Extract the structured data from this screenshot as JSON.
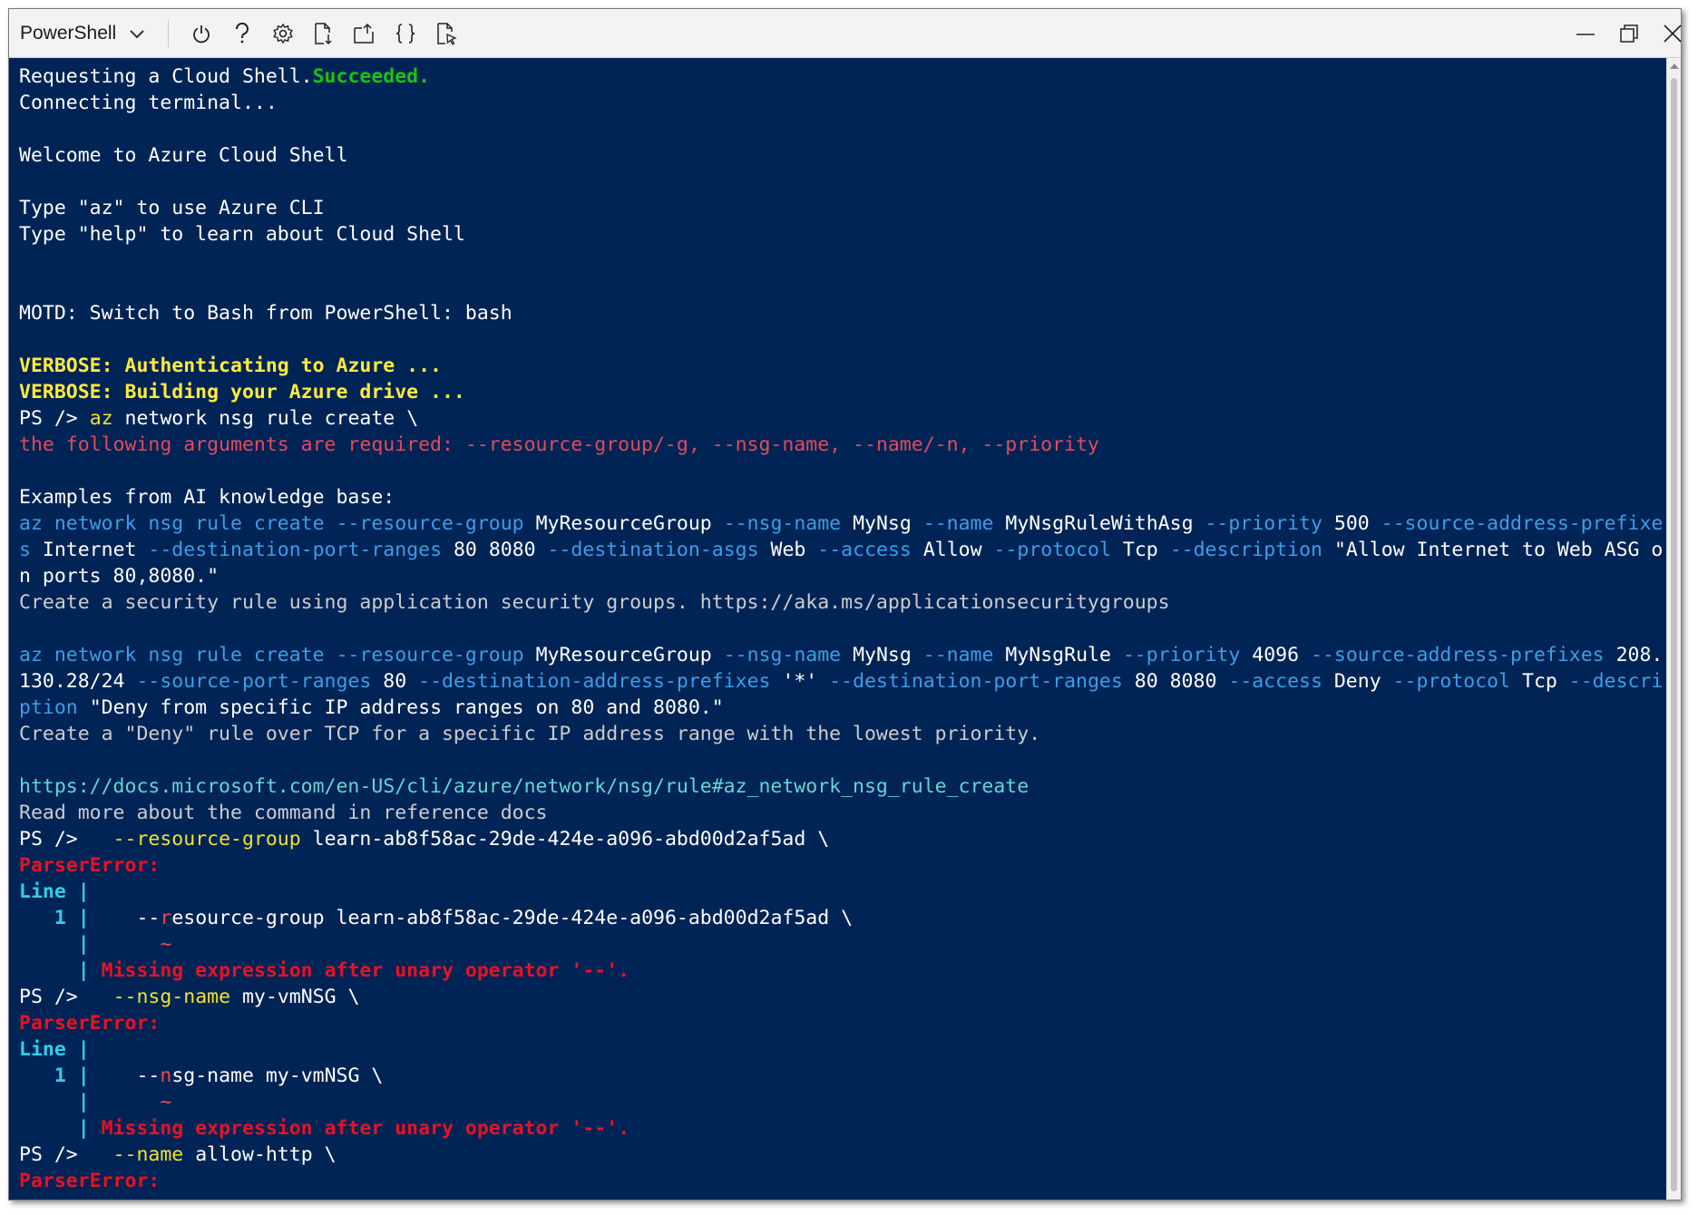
{
  "toolbar": {
    "shell_name": "PowerShell",
    "icons": [
      "power-icon",
      "help-icon",
      "settings-icon",
      "upload-download-icon",
      "open-new-session-icon",
      "editor-braces-icon",
      "web-preview-icon"
    ],
    "window_icons": [
      "minimize-icon",
      "restore-icon",
      "close-icon"
    ]
  },
  "colors": {
    "terminal_background": "#012456",
    "success": "#16c60c",
    "verbose": "#ffeb3b",
    "error": "#e74856",
    "parameter": "#3b9ee8",
    "link": "#61d6d6"
  },
  "terminal": {
    "l1a": "Requesting a Cloud Shell.",
    "l1b": "Succeeded.",
    "l2": "Connecting terminal...",
    "l3": "Welcome to Azure Cloud Shell",
    "l4": "Type \"az\" to use Azure CLI",
    "l5": "Type \"help\" to learn about Cloud Shell",
    "l6": "MOTD: Switch to Bash from PowerShell: bash",
    "l7": "VERBOSE: Authenticating to Azure ...",
    "l8": "VERBOSE: Building your Azure drive ...",
    "prompt": "PS />",
    "l9_cmd": "az",
    "l9_rest": "network nsg rule create \\",
    "l10": "the following arguments are required: --resource-group/-g, --nsg-name, --name/-n, --priority",
    "l11": "Examples from AI knowledge base:",
    "ex1": {
      "p1": "az network nsg rule create --resource-group",
      "v1": "MyResourceGroup",
      "p2": "--nsg-name",
      "v2": "MyNsg",
      "p3": "--name",
      "v3": "MyNsgRuleWithAsg",
      "p4": "--priority",
      "v4": "500",
      "p5": "--source-address-prefixe",
      "p5b": "s",
      "v5": "Internet",
      "p6": "--destination-port-ranges",
      "v6": "80 8080",
      "p7": "--destination-asgs",
      "v7": "Web",
      "p8": "--access",
      "v8": "Allow",
      "p9": "--protocol",
      "v9": "Tcp",
      "p10": "--description",
      "v10a": "\"Allow Internet to Web ASG o",
      "v10b": "n ports 80,8080.\"",
      "desc": "Create a security rule using application security groups. https://aka.ms/applicationsecuritygroups"
    },
    "ex2": {
      "p1": "az network nsg rule create --resource-group",
      "v1": "MyResourceGroup",
      "p2": "--nsg-name",
      "v2": "MyNsg",
      "p3": "--name",
      "v3": "MyNsgRule",
      "p4": "--priority",
      "v4": "4096",
      "p5": "--source-address-prefixes",
      "v5a": "208.",
      "v5b": "130.28/24",
      "p6": "--source-port-ranges",
      "v6": "80",
      "p7": "--destination-address-prefixes",
      "v7": "'*'",
      "p8": "--destination-port-ranges",
      "v8": "80 8080",
      "p9": "--access",
      "v9": "Deny",
      "p10": "--protocol",
      "v10": "Tcp",
      "p11a": "--descri",
      "p11b": "ption",
      "v11": "\"Deny from specific IP address ranges on 80 and 8080.\"",
      "desc": "Create a \"Deny\" rule over TCP for a specific IP address range with the lowest priority."
    },
    "docs_link": "https://docs.microsoft.com/en-US/cli/azure/network/nsg/rule#az_network_nsg_rule_create",
    "docs_note": "Read more about the command in reference docs",
    "err1": {
      "cmd_a": "--",
      "cmd_b": "resource-group",
      "arg": "learn-ab8f58ac-29de-424e-a096-abd00d2af5ad \\",
      "line_code_a": "--",
      "line_code_b": "r",
      "line_code_c": "esource-group learn-ab8f58ac-29de-424e-a096-abd00d2af5ad \\"
    },
    "err2": {
      "cmd_a": "--",
      "cmd_b": "nsg-name",
      "arg": "my-vmNSG \\",
      "line_code_a": "--",
      "line_code_b": "n",
      "line_code_c": "sg-name my-vmNSG \\"
    },
    "err3": {
      "cmd_a": "--",
      "cmd_b": "name",
      "arg": "allow-http \\"
    },
    "parser_error": "ParserError:",
    "line_label": "Line",
    "line_no": "1",
    "tilde": "~",
    "missing_expr": "Missing expression after unary operator '--'."
  }
}
